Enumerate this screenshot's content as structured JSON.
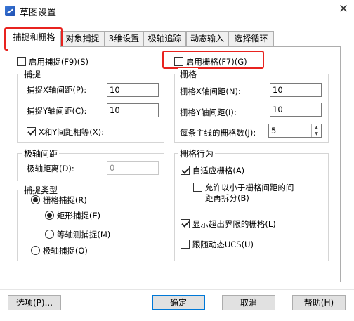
{
  "window": {
    "title": "草图设置",
    "close_symbol": "✕",
    "icon": "app-icon"
  },
  "tabs": [
    {
      "label": "捕捉和栅格",
      "active": true
    },
    {
      "label": "对象捕捉",
      "active": false
    },
    {
      "label": "3维设置",
      "active": false
    },
    {
      "label": "极轴追踪",
      "active": false
    },
    {
      "label": "动态输入",
      "active": false
    },
    {
      "label": "选择循环",
      "active": false
    }
  ],
  "snap": {
    "enable_label": "启用捕捉(F9)(S)",
    "enable_checked": false,
    "group_title": "捕捉",
    "x_spacing_label": "捕捉X轴间距(P):",
    "x_spacing_value": "10",
    "y_spacing_label": "捕捉Y轴间距(C):",
    "y_spacing_value": "10",
    "equal_xy_label": "X和Y间距相等(X):",
    "equal_xy_checked": true
  },
  "polar": {
    "group_title": "极轴间距",
    "distance_label": "极轴距离(D):",
    "distance_value": "0"
  },
  "snap_type": {
    "group_title": "捕捉类型",
    "grid_snap_label": "栅格捕捉(R)",
    "rect_snap_label": "矩形捕捉(E)",
    "iso_snap_label": "等轴测捕捉(M)",
    "polar_snap_label": "极轴捕捉(O)"
  },
  "grid": {
    "enable_label": "启用栅格(F7)(G)",
    "enable_checked": false,
    "group_title": "栅格",
    "x_spacing_label": "栅格X轴间距(N):",
    "x_spacing_value": "10",
    "y_spacing_label": "栅格Y轴间距(I):",
    "y_spacing_value": "10",
    "major_label": "每条主线的栅格数(J):",
    "major_value": "5"
  },
  "grid_behavior": {
    "group_title": "栅格行为",
    "adaptive_label": "自适应栅格(A)",
    "adaptive_checked": true,
    "subdivide_label_1": "允许以小于栅格间距的间",
    "subdivide_label_2": "距再拆分(B)",
    "subdivide_checked": false,
    "beyond_limits_label": "显示超出界限的栅格(L)",
    "beyond_limits_checked": true,
    "follow_ucs_label": "跟随动态UCS(U)",
    "follow_ucs_checked": false
  },
  "buttons": {
    "options": "选项(P)...",
    "ok": "确定",
    "cancel": "取消",
    "help": "帮助(H)"
  },
  "spin_up": "▲",
  "spin_down": "▼"
}
